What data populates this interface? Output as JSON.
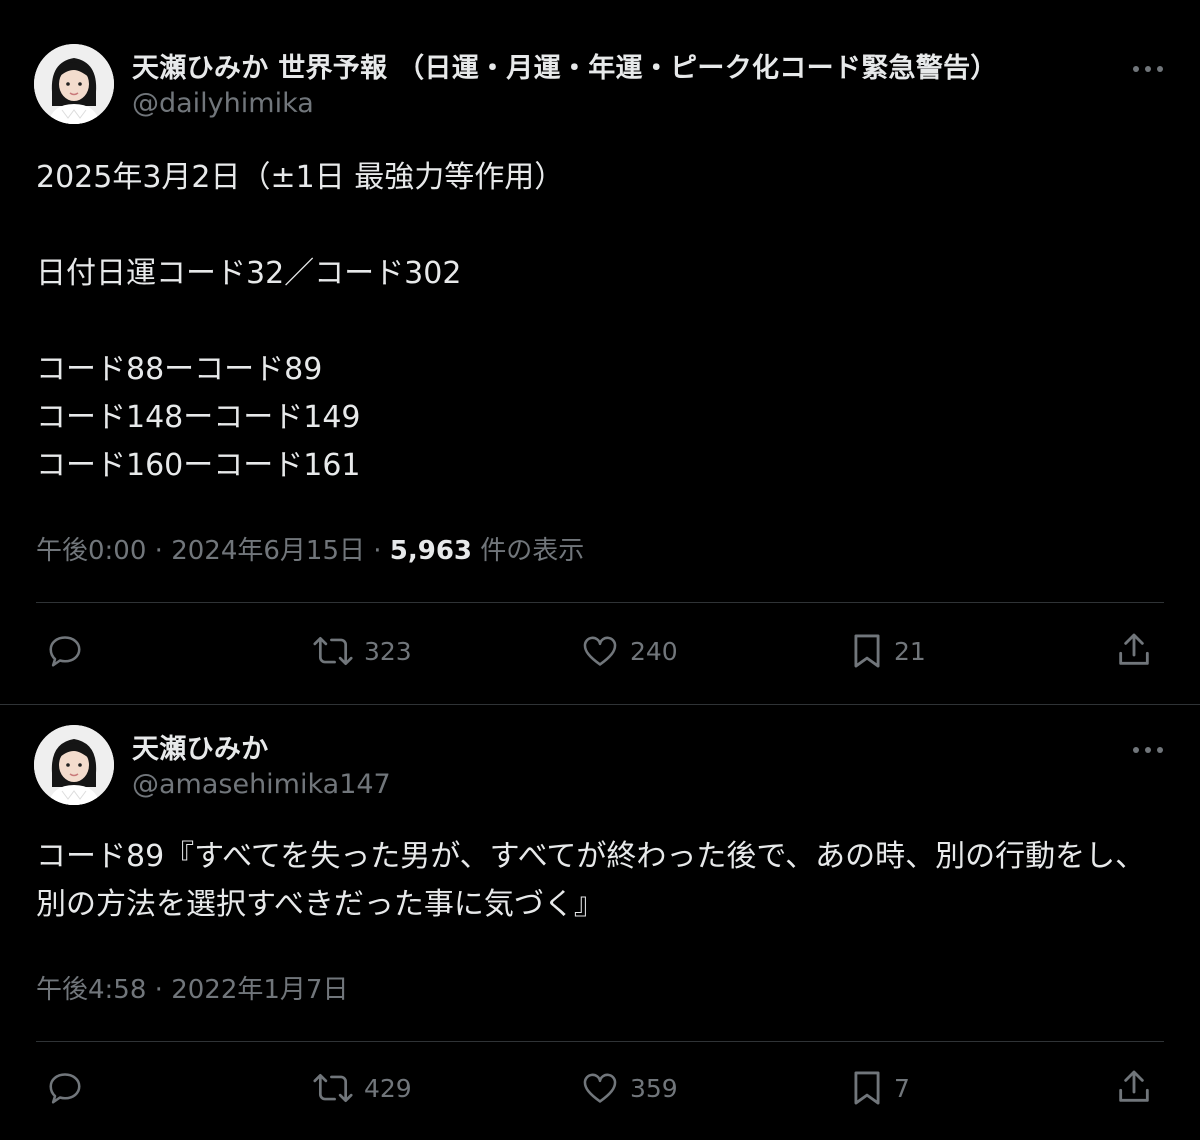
{
  "tweets": [
    {
      "display_name": "天瀬ひみか 世界予報 （日運・月運・年運・ピーク化コード緊急警告）",
      "handle": "@dailyhimika",
      "text": "2025年3月2日（±1日 最強力等作用）\n\n日付日運コード32／コード302\n\nコード88ーコード89\nコード148ーコード149\nコード160ーコード161",
      "time": "午後0:00",
      "separator": "·",
      "date": "2024年6月15日",
      "views_count": "5,963",
      "views_label": "件の表示",
      "retweets": "323",
      "likes": "240",
      "bookmarks": "21",
      "more_icon": "more-dots-icon"
    },
    {
      "display_name": "天瀬ひみか",
      "handle": "@amasehimika147",
      "text": "コード89『すべてを失った男が、すべてが終わった後で、あの時、別の行動をし、別の方法を選択すべきだった事に気づく』",
      "time": "午後4:58",
      "separator": "·",
      "date": "2022年1月7日",
      "retweets": "429",
      "likes": "359",
      "bookmarks": "7",
      "more_icon": "more-dots-icon"
    }
  ],
  "colors": {
    "background": "#000000",
    "primary_text": "#e7e9ea",
    "secondary_text": "#71767b",
    "divider": "#2f3336"
  },
  "icons": [
    "reply-icon",
    "retweet-icon",
    "like-icon",
    "bookmark-icon",
    "share-icon",
    "more-dots-icon"
  ]
}
